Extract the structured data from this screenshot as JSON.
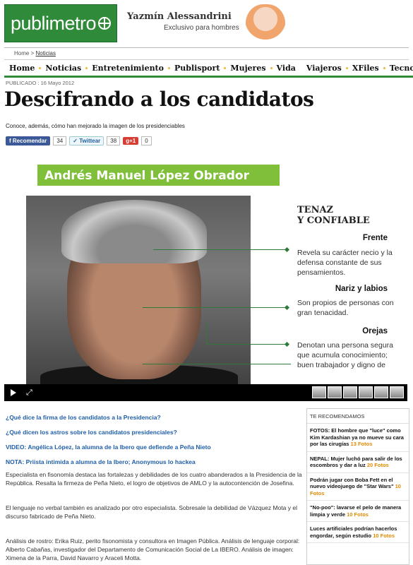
{
  "header": {
    "logo_text": "publimetro",
    "promo_name": "Yazmín Alessandrini",
    "promo_sub": "Exclusivo para hombres"
  },
  "breadcrumb": [
    "Home",
    ">",
    "Noticias"
  ],
  "nav": [
    "Home",
    "Noticias",
    "Entretenimiento",
    "Publisport",
    "Mujeres",
    "Vida",
    "Viajeros",
    "XFiles",
    "Tecno"
  ],
  "article": {
    "published": "PUBLICADO : 16 Mayo 2012",
    "title": "Descifrando a los candidatos",
    "subtitle": "Conoce, además, cómo han mejorado la imagen de los presidenciables",
    "social": {
      "fb_label": "Recomendar",
      "fb_count": "34",
      "tw_label": "Twittear",
      "tw_count": "38",
      "gp_label": "g+1",
      "gp_count": "0"
    }
  },
  "graphic": {
    "banner": "Andrés Manuel López Obrador",
    "heading_line1": "TENAZ",
    "heading_line2": "Y CONFIABLE",
    "items": [
      {
        "label": "Frente",
        "text": "Revela su carácter necio y la defensa constante de sus pensamientos."
      },
      {
        "label": "Nariz y labios",
        "text": "Son propios de personas con gran tenacidad."
      },
      {
        "label": "Orejas",
        "text": "Denotan una persona segura que acumula conocimiento; buen trabajador y digno de"
      }
    ]
  },
  "links": [
    {
      "prefix": "",
      "text": "¿Qué dice la firma de los candidatos a la Presidencia?"
    },
    {
      "prefix": "",
      "text": "¿Qué dicen los astros sobre los candidatos presidenciales?"
    },
    {
      "prefix": "VIDEO:",
      "text": "Angélica López, la alumna de la Ibero que defiende a Peña Nieto"
    },
    {
      "prefix": "NOTA:",
      "text": "Priista intimida a alumna de la Ibero; Anonymous lo hackea"
    }
  ],
  "paragraphs": [
    "Especialista en fisonomía destaca las fortalezas y debilidades de los cuatro abanderados a la Presidencia de la República. Resalta la firmeza de Peña Nieto, el logro de objetivos de AMLO y la autocontención de Josefina.",
    "El lenguaje no verbal también es analizado por otro especialista. Sobresale la debilidad de Vázquez Mota y el discurso fabricado de Peña Nieto.",
    "Análisis de rostro: Erika Ruiz, perito fisonomista y consultora en Imagen Pública. Análisis de lenguaje corporal: Alberto Cabañas, investigador del Departamento de Comunicación Social de La IBERO. Análisis de imagen: Ximena de la Parra, David Navarro y Araceli Motta."
  ],
  "sidebar": {
    "title": "TE RECOMENDAMOS",
    "items": [
      {
        "text": "FOTOS: El hombre que \"luce\" como Kim Kardashian ya no mueve su cara por las cirugías",
        "fotos": "13 Fotos"
      },
      {
        "text": "NEPAL: Mujer luchó para salir de los escombros y dar a luz",
        "fotos": "20 Fotos"
      },
      {
        "text": "Podrán jugar con Boba Fett en el nuevo videojuego de \"Star Wars\"",
        "fotos": "10 Fotos"
      },
      {
        "text": "\"No-poo\": lavarse el pelo de manera limpia y verde",
        "fotos": "10 Fotos"
      },
      {
        "text": "Luces artificiales podrían hacerlos engordar, según estudio",
        "fotos": "10 Fotos"
      }
    ]
  },
  "colors": {
    "brand_green": "#2f8a3a",
    "link_blue": "#1f5ea8",
    "accent_orange": "#e08a00"
  }
}
